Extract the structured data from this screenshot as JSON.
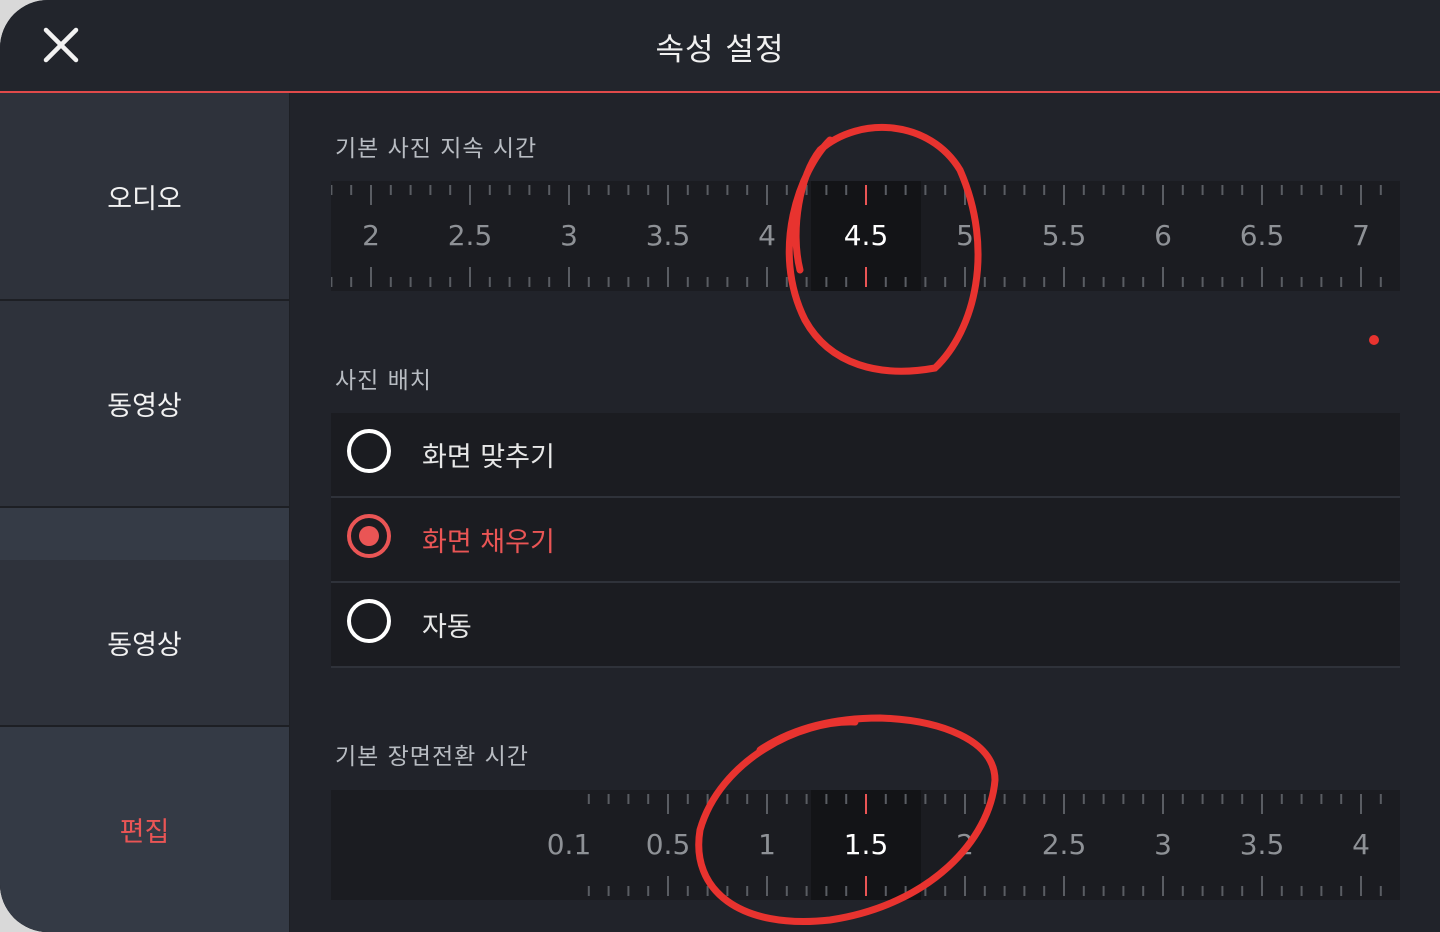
{
  "header": {
    "title": "속성 설정"
  },
  "sidebar": {
    "items": [
      {
        "label": "오디오"
      },
      {
        "label": "동영상"
      },
      {
        "label": "동영상"
      },
      {
        "label": "편집"
      }
    ]
  },
  "photo_duration": {
    "label": "기본 사진 지속 시간",
    "ticks": [
      "2",
      "2.5",
      "3",
      "3.5",
      "4",
      "4.5",
      "5",
      "5.5",
      "6",
      "6.5",
      "7"
    ],
    "selected": "4.5"
  },
  "photo_placement": {
    "label": "사진 배치",
    "options": [
      {
        "label": "화면 맞추기",
        "checked": false
      },
      {
        "label": "화면 채우기",
        "checked": true
      },
      {
        "label": "자동",
        "checked": false
      }
    ]
  },
  "transition_duration": {
    "label": "기본 장면전환 시간",
    "ticks": [
      "0.1",
      "0.5",
      "1",
      "1.5",
      "2",
      "2.5",
      "3",
      "3.5",
      "4"
    ],
    "selected": "1.5"
  },
  "colors": {
    "accent": "#ea5555",
    "background": "#21232a",
    "ruler": "#1b1c21"
  },
  "icons": {
    "close": "close-icon"
  }
}
